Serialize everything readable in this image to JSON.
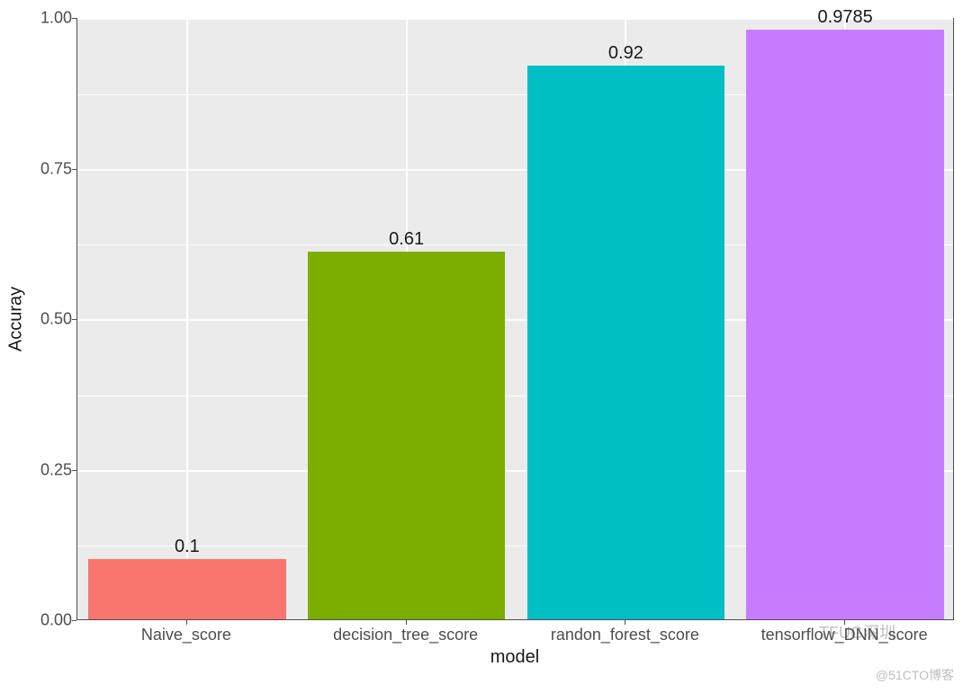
{
  "chart_data": {
    "type": "bar",
    "categories": [
      "Naive_score",
      "decision_tree_score",
      "randon_forest_score",
      "tensorflow_DNN_score"
    ],
    "values": [
      0.1,
      0.61,
      0.92,
      0.9785
    ],
    "value_labels": [
      "0.1",
      "0.61",
      "0.92",
      "0.9785"
    ],
    "colors": [
      "#f8766d",
      "#7cae00",
      "#00bfc4",
      "#c77cff"
    ],
    "xlabel": "model",
    "ylabel": "Accuray",
    "ylim": [
      0,
      1.0
    ],
    "yticks": [
      0.0,
      0.25,
      0.5,
      0.75,
      1.0
    ],
    "ytick_labels": [
      "0.00",
      "0.25",
      "0.50",
      "0.75",
      "1.00"
    ]
  },
  "watermark1": "TFUG深圳",
  "watermark2": "@51CTO博客"
}
